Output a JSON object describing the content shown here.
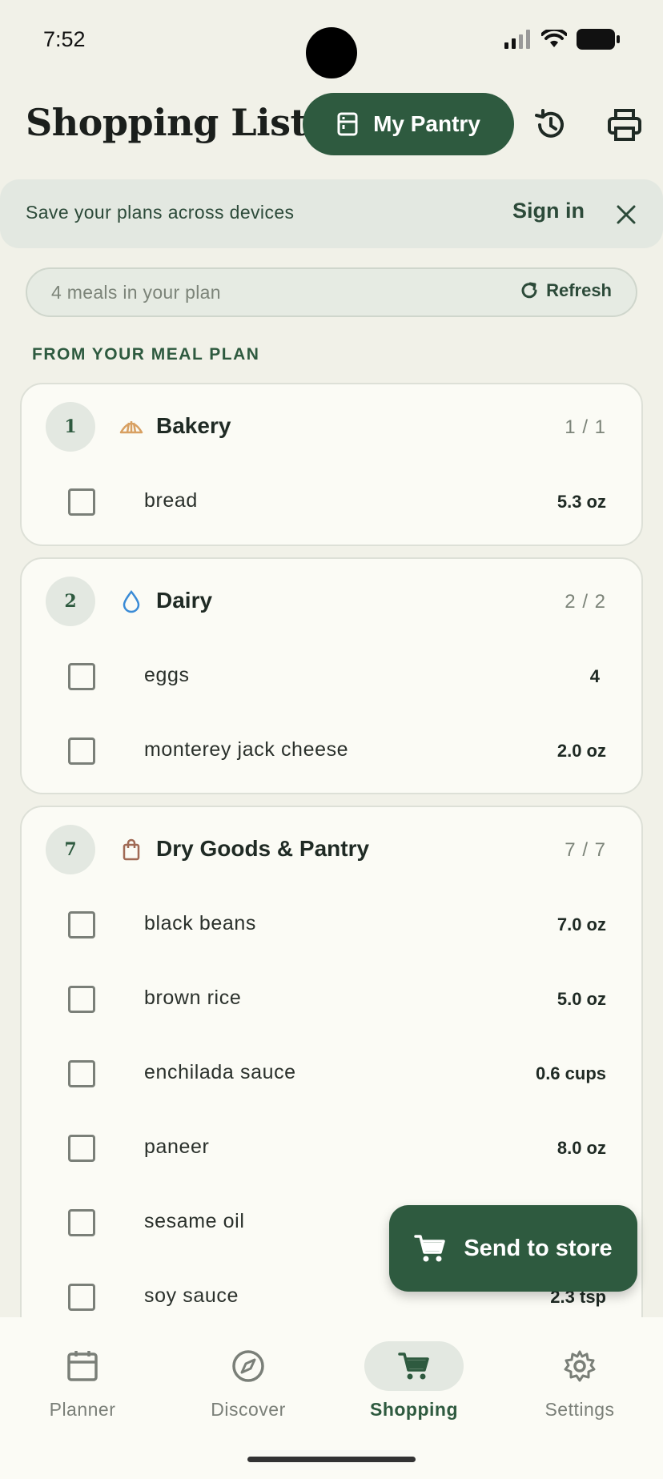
{
  "status": {
    "time": "7:52"
  },
  "header": {
    "title": "Shopping List",
    "pantry_label": "My Pantry"
  },
  "banner": {
    "text": "Save your plans across devices",
    "signin_label": "Sign in"
  },
  "plan": {
    "text": "4 meals in your plan",
    "refresh_label": "Refresh"
  },
  "section_label": "FROM YOUR MEAL PLAN",
  "categories": [
    {
      "count": "1",
      "name": "Bakery",
      "progress": "1 / 1",
      "icon": "croissant-icon",
      "items": [
        {
          "name": "bread",
          "qty": "5.3 oz"
        }
      ]
    },
    {
      "count": "2",
      "name": "Dairy",
      "progress": "2 / 2",
      "icon": "water-drop-icon",
      "items": [
        {
          "name": "eggs",
          "qty": "4"
        },
        {
          "name": "monterey jack cheese",
          "qty": "2.0 oz"
        }
      ]
    },
    {
      "count": "7",
      "name": "Dry Goods & Pantry",
      "progress": "7 / 7",
      "icon": "shopping-bag-icon",
      "items": [
        {
          "name": "black beans",
          "qty": "7.0 oz"
        },
        {
          "name": "brown rice",
          "qty": "5.0 oz"
        },
        {
          "name": "enchilada sauce",
          "qty": "0.6 cups"
        },
        {
          "name": "paneer",
          "qty": "8.0 oz"
        },
        {
          "name": "sesame oil",
          "qty": ""
        },
        {
          "name": "soy sauce",
          "qty": "2.3 tsp"
        }
      ]
    }
  ],
  "send_button_label": "Send to store",
  "nav": [
    {
      "label": "Planner",
      "icon": "calendar-icon"
    },
    {
      "label": "Discover",
      "icon": "compass-icon"
    },
    {
      "label": "Shopping",
      "icon": "cart-icon"
    },
    {
      "label": "Settings",
      "icon": "gear-icon"
    }
  ],
  "colors": {
    "accent": "#2e5a3f",
    "background": "#f1f1e8",
    "card": "#fbfbf5"
  }
}
